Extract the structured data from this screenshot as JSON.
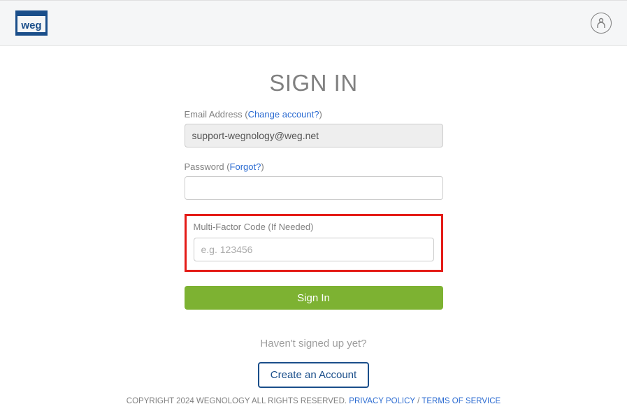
{
  "header": {
    "logo_text": "weg"
  },
  "title": "SIGN IN",
  "email": {
    "label": "Email Address",
    "change_link": "Change account?",
    "value": "support-wegnology@weg.net"
  },
  "password": {
    "label": "Password",
    "forgot_link": "Forgot?",
    "value": ""
  },
  "mfa": {
    "label": "Multi-Factor Code (If Needed)",
    "placeholder": "e.g. 123456",
    "value": ""
  },
  "signin_button": "Sign In",
  "signup_prompt": "Haven't signed up yet?",
  "create_account_button": "Create an Account",
  "footer": {
    "copyright": "COPYRIGHT 2024 WEGNOLOGY ALL RIGHTS RESERVED.",
    "privacy": "PRIVACY POLICY",
    "terms": "TERMS OF SERVICE"
  }
}
